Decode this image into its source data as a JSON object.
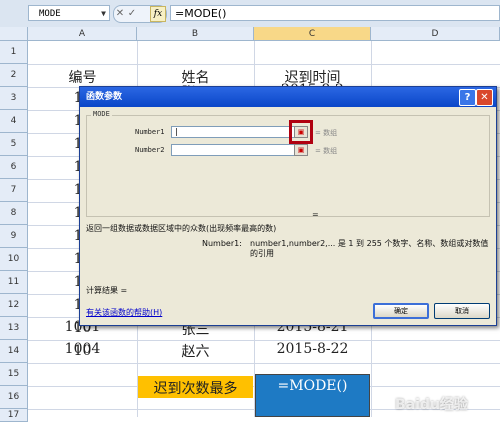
{
  "formula_bar": {
    "name_box": "MODE",
    "cancel_glyph": "✕",
    "enter_glyph": "✓",
    "fx_glyph": "fx",
    "formula": "=MODE()"
  },
  "columns": [
    "A",
    "B",
    "C",
    "D"
  ],
  "rows": [
    "1",
    "2",
    "3",
    "4",
    "5",
    "6",
    "7",
    "8",
    "9",
    "10",
    "11",
    "12",
    "13",
    "14",
    "15",
    "16",
    "17",
    "18"
  ],
  "cells": {
    "a2": "编号",
    "b2": "姓名",
    "c2": "迟到时间",
    "a3": "10",
    "b3": "张三",
    "c3": "2015-8-2",
    "a4": "10",
    "a5": "10",
    "a6": "10",
    "a7": "10",
    "a8": "10",
    "a9": "10",
    "a10": "10",
    "a11": "10",
    "a12": "10",
    "a13": "10",
    "a14": "10",
    "a15": "1001",
    "b15": "张三",
    "c15": "2015-8-21",
    "a16": "1004",
    "b16": "赵六",
    "c16": "2015-8-22",
    "b18": "迟到次数最多",
    "c18": "=MODE()"
  },
  "dialog": {
    "title": "函数参数",
    "help_glyph": "?",
    "close_glyph": "✕",
    "group_label": "MODE",
    "args": [
      {
        "label": "Number1",
        "value": "",
        "hint": "= 数组"
      },
      {
        "label": "Number2",
        "value": "",
        "hint": "= 数组"
      }
    ],
    "result_eq": "=",
    "description": "返回一组数据或数据区域中的众数(出现频率最高的数)",
    "arg_help_name": "Number1:",
    "arg_help_text": "number1,number2,... 是 1 到 255 个数字、名称、数组或对数值的引用",
    "result_label": "计算结果 =",
    "help_link": "有关该函数的帮助(H)",
    "ok": "确定",
    "cancel": "取消"
  },
  "colors": {
    "selected_header": "#f8d888",
    "yellow_fill": "#ffc000",
    "blue_fill": "#1e7ac4",
    "red_highlight": "#b00010"
  },
  "watermark": "Baidu经验"
}
